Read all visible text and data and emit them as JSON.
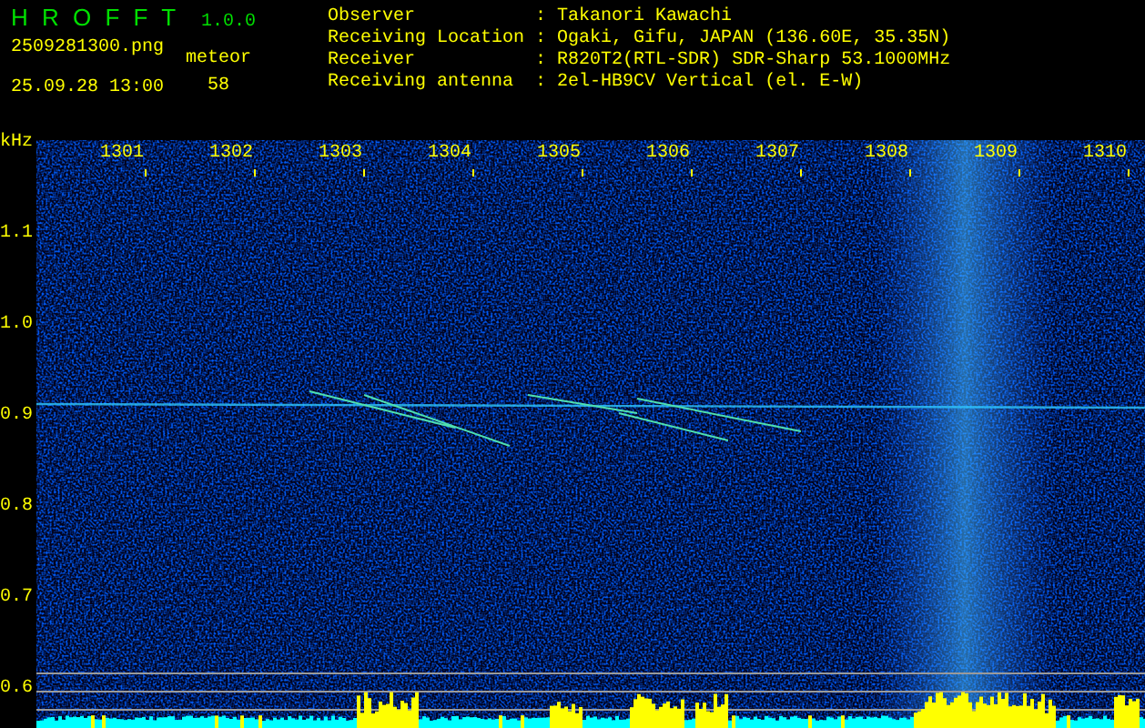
{
  "app": {
    "title": "H R O F F T",
    "version": "1.0.0"
  },
  "file": {
    "name": "2509281300.png",
    "timestamp": "25.09.28 13:00"
  },
  "counter": {
    "label": "meteor",
    "value": "58"
  },
  "info": [
    {
      "label": "Observer",
      "separator": ":",
      "value": "Takanori Kawachi"
    },
    {
      "label": "Receiving Location",
      "separator": ":",
      "value": "Ogaki, Gifu, JAPAN (136.60E, 35.35N)"
    },
    {
      "label": "Receiver",
      "separator": ":",
      "value": "R820T2(RTL-SDR) SDR-Sharp 53.1000MHz"
    },
    {
      "label": "Receiving antenna",
      "separator": ":",
      "value": "2el-HB9CV Vertical (el. E-W)"
    }
  ],
  "spectrogram": {
    "unit": "kHz",
    "x_labels": [
      "1301",
      "1302",
      "1303",
      "1304",
      "1305",
      "1306",
      "1307",
      "1308",
      "1309",
      "1310"
    ],
    "y_labels": [
      "1.1",
      "1.0",
      "0.9",
      "0.8",
      "0.7",
      "0.6"
    ]
  }
}
